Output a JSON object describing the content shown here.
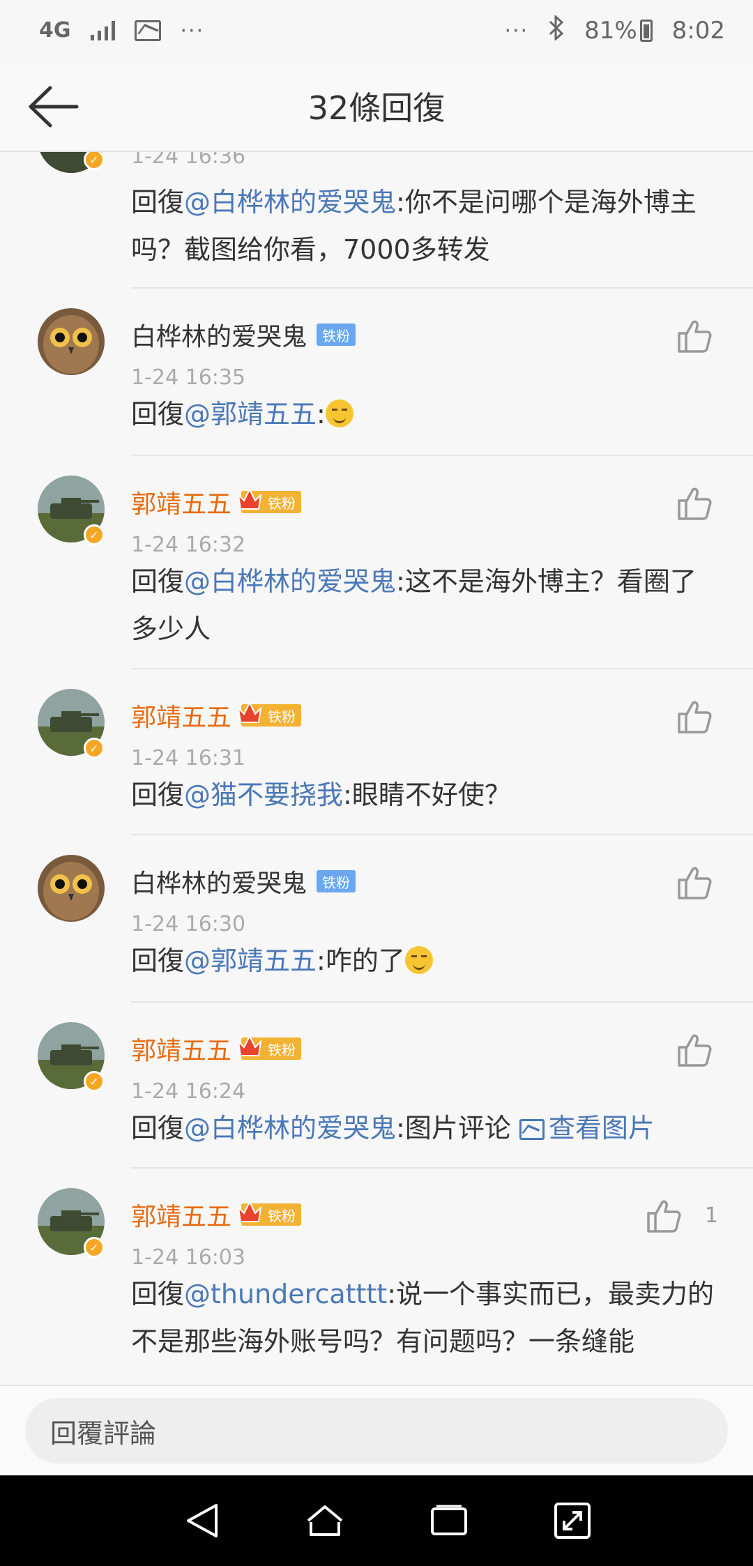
{
  "status_bar": {
    "network": "4G",
    "more": "···",
    "battery": "81%",
    "time": "8:02"
  },
  "header": {
    "title": "32條回復"
  },
  "comments": [
    {
      "time": "1-24 16:36",
      "prefix": "回復",
      "mention": "@白桦林的爱哭鬼",
      "text": ":你不是问哪个是海外博主吗？截图给你看，7000多转发"
    },
    {
      "name": "白桦林的爱哭鬼",
      "badge": "铁粉",
      "time": "1-24 16:35",
      "prefix": "回復",
      "mention": "@郭靖五五",
      "text": ":"
    },
    {
      "name": "郭靖五五",
      "badge": "铁粉",
      "time": "1-24 16:32",
      "prefix": "回復",
      "mention": "@白桦林的爱哭鬼",
      "text": ":这不是海外博主？看圈了多少人"
    },
    {
      "name": "郭靖五五",
      "badge": "铁粉",
      "time": "1-24 16:31",
      "prefix": "回復",
      "mention": "@猫不要挠我",
      "text": ":眼睛不好使？"
    },
    {
      "name": "白桦林的爱哭鬼",
      "badge": "铁粉",
      "time": "1-24 16:30",
      "prefix": "回復",
      "mention": "@郭靖五五",
      "text": ":咋的了"
    },
    {
      "name": "郭靖五五",
      "badge": "铁粉",
      "time": "1-24 16:24",
      "prefix": "回復",
      "mention": "@白桦林的爱哭鬼",
      "text": ":图片评论 ",
      "link": "查看图片"
    },
    {
      "name": "郭靖五五",
      "badge": "铁粉",
      "time": "1-24 16:03",
      "likes": "1",
      "prefix": "回復",
      "mention": "@thundercatttt",
      "text": ":说一个事实而已，最卖力的不是那些海外账号吗？有问题吗？一条缝能"
    }
  ],
  "reply_bar": {
    "placeholder": "回覆評論"
  },
  "icons": {
    "back": "arrow-left-icon",
    "like": "thumbs-up-icon",
    "verified": "verified-badge-icon",
    "crown": "crown-icon",
    "image": "image-icon"
  },
  "colors": {
    "vip_name": "#e86b0f",
    "mention": "#4a78b8",
    "fan_badge_blue": "#6aa7ef",
    "fan_badge_gold": "#f2b233"
  }
}
